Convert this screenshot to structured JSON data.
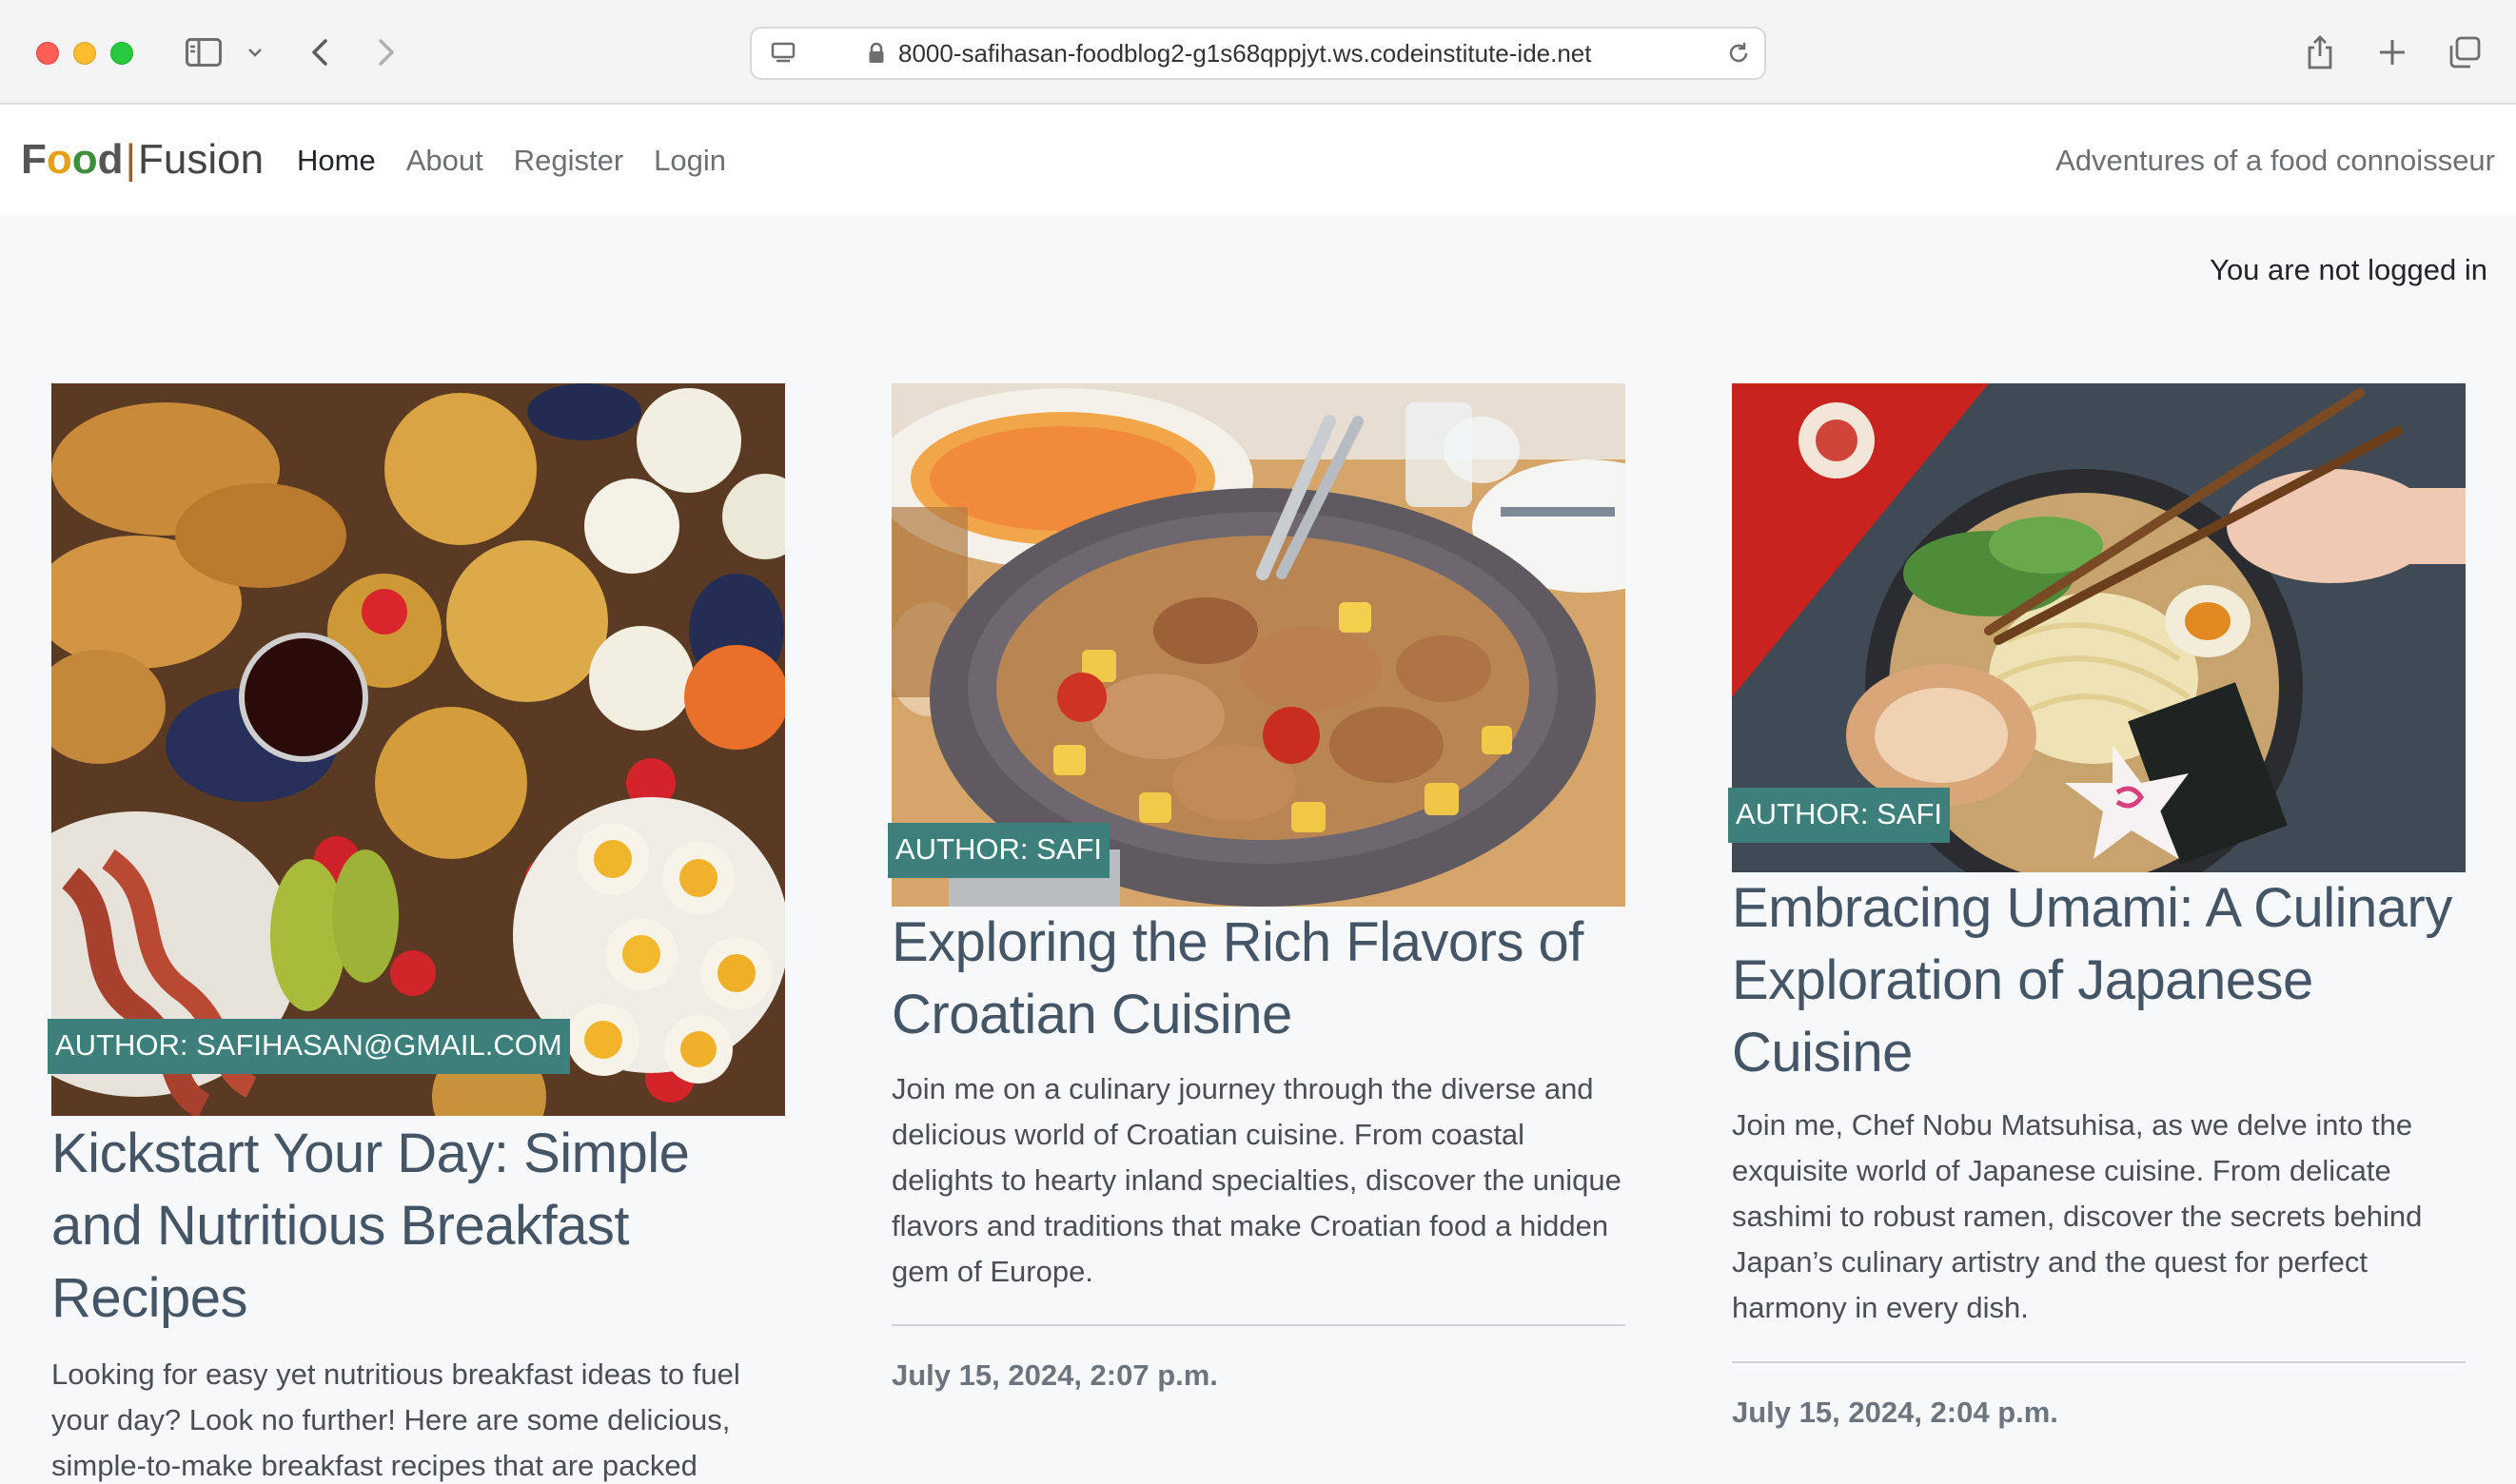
{
  "browser": {
    "url": "8000-safihasan-foodblog2-g1s68qppjyt.ws.codeinstitute-ide.net"
  },
  "navbar": {
    "brand": {
      "part1": "Food",
      "separator": "|",
      "part2": "Fusion"
    },
    "links": [
      {
        "label": "Home",
        "active": true
      },
      {
        "label": "About"
      },
      {
        "label": "Register"
      },
      {
        "label": "Login"
      }
    ],
    "tagline": "Adventures of a food connoisseur"
  },
  "status": {
    "login_text": "You are not logged in"
  },
  "posts": [
    {
      "author": "AUTHOR: SAFIHASAN@GMAIL.COM",
      "title": "Kickstart Your Day: Simple and Nutritious Breakfast Recipes",
      "excerpt": "Looking for easy yet nutritious breakfast ideas to fuel your day? Look no further! Here are some delicious, simple-to-make breakfast recipes that are packed",
      "date": ""
    },
    {
      "author": "AUTHOR: SAFI",
      "title": "Exploring the Rich Flavors of Croatian Cuisine",
      "excerpt": "Join me on a culinary journey through the diverse and delicious world of Croatian cuisine. From coastal delights to hearty inland specialties, discover the unique flavors and traditions that make Croatian food a hidden gem of Europe.",
      "date": "July 15, 2024, 2:07 p.m."
    },
    {
      "author": "AUTHOR: SAFI",
      "title": "Embracing Umami: A Culinary Exploration of Japanese Cuisine",
      "excerpt": "Join me, Chef Nobu Matsuhisa, as we delve into the exquisite world of Japanese cuisine. From delicate sashimi to robust ramen, discover the secrets behind Japan’s culinary artistry and the quest for perfect harmony in every dish.",
      "date": "July 15, 2024, 2:04 p.m."
    }
  ],
  "colors": {
    "author_badge": "#3d7f7a",
    "brand_F": "#c0392b",
    "brand_o1": "#e6a01a",
    "brand_o2": "#3f8f3a",
    "brand_d": "#3d6fb5"
  }
}
